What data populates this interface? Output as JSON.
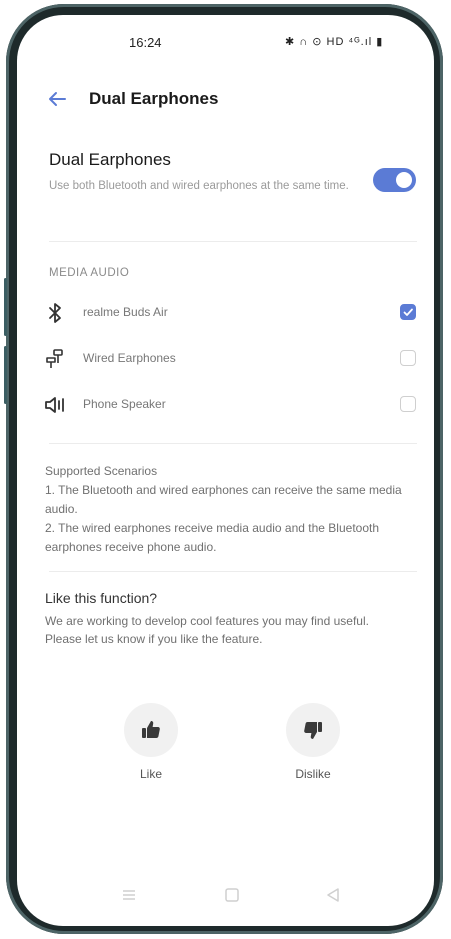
{
  "status_bar": {
    "time": "16:24",
    "icons_text": "✱ ∩ ⊙ HD ⁴ᴳ.ıl ▮"
  },
  "header": {
    "title": "Dual Earphones"
  },
  "main_setting": {
    "title": "Dual Earphones",
    "description": "Use both Bluetooth and wired earphones at the same time.",
    "enabled": true
  },
  "media_audio": {
    "section_title": "MEDIA AUDIO",
    "items": [
      {
        "label": "realme Buds Air",
        "icon": "bluetooth-icon",
        "checked": true
      },
      {
        "label": "Wired Earphones",
        "icon": "wired-earphones-icon",
        "checked": false
      },
      {
        "label": "Phone Speaker",
        "icon": "speaker-icon",
        "checked": false
      }
    ]
  },
  "scenarios": {
    "title": "Supported Scenarios",
    "line1": "1. The Bluetooth and wired earphones can receive the same media audio.",
    "line2": "2. The wired earphones receive media audio and the Bluetooth earphones receive phone audio."
  },
  "feedback": {
    "title": "Like this function?",
    "description": "We are working to develop cool features you may find useful. Please let us know if you like the feature.",
    "like_label": "Like",
    "dislike_label": "Dislike"
  },
  "colors": {
    "accent": "#5b7bd5",
    "frame": "#1e2a2b"
  }
}
